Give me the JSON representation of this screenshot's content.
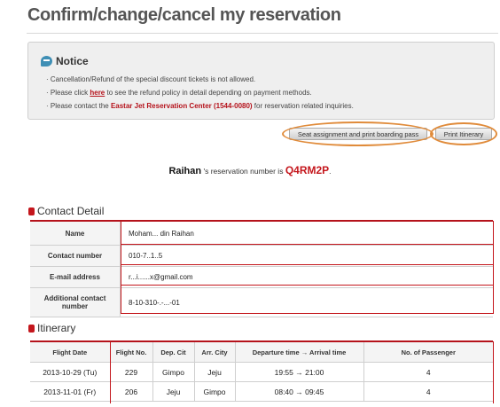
{
  "page": {
    "title": "Confirm/change/cancel my reservation"
  },
  "notice": {
    "title": "Notice",
    "icon": "speech-bubble-icon",
    "line1": "Cancellation/Refund of the special discount tickets is not allowed.",
    "line2_before": "Please click ",
    "line2_link": "here",
    "line2_after": " to see the refund policy in detail depending on payment methods.",
    "line3_before": "Please contact the ",
    "line3_center": "Eastar Jet Reservation Center (1544-0080)",
    "line3_after": " for reservation related inquiries."
  },
  "buttons": {
    "seat": "Seat assignment and print boarding pass",
    "print": "Print Itinerary"
  },
  "reservation": {
    "name": "Raihan",
    "text": " 's reservation number is ",
    "number": "Q4RM2P",
    "period": "."
  },
  "contact": {
    "section_title": "Contact Detail",
    "rows": [
      {
        "label": "Name",
        "value": "Moham... din Raihan"
      },
      {
        "label": "Contact number",
        "value": "010-7..1..5"
      },
      {
        "label": "E-mail address",
        "value": "r...i......x@gmail.com"
      },
      {
        "label": "Additional contact number",
        "value": "8-10-310-.-...-01"
      }
    ]
  },
  "itinerary": {
    "section_title": "Itinerary",
    "columns": [
      "Flight Date",
      "Flight No.",
      "Dep. Cit",
      "Arr. City",
      "Departure time → Arrival time",
      "No. of Passenger"
    ],
    "rows": [
      [
        "2013-10-29 (Tu)",
        "229",
        "Gimpo",
        "Jeju",
        "19:55 → 21:00",
        "4"
      ],
      [
        "2013-11-01 (Fr)",
        "206",
        "Jeju",
        "Gimpo",
        "08:40 → 09:45",
        "4"
      ]
    ]
  },
  "colors": {
    "accent_red": "#c4161c",
    "annotation_orange": "#e08b3a",
    "notice_blue": "#3f8fb5"
  }
}
